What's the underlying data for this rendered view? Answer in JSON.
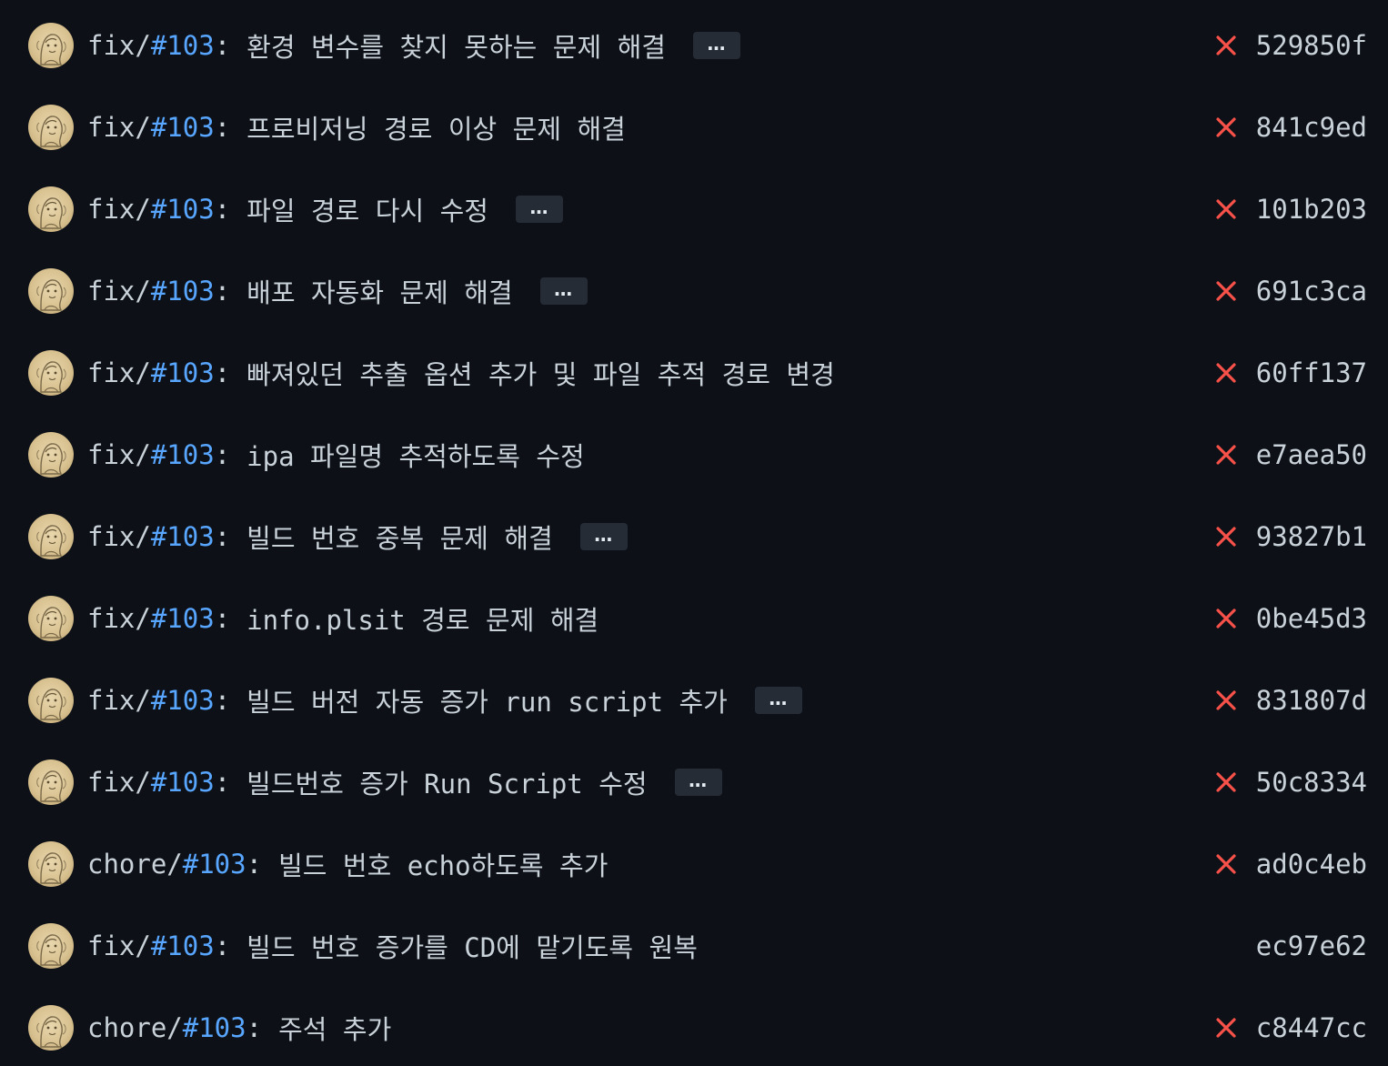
{
  "colors": {
    "background": "#0d1117",
    "text": "#c9d1d9",
    "issue_link": "#58a6ff",
    "status_failure": "#f85149",
    "ellipsis_button": "#262c36"
  },
  "commits": [
    {
      "prefix": "fix/",
      "issue": "#103",
      "colon": ":",
      "subject": "환경 변수를 찾지 못하는 문제 해결",
      "has_more": true,
      "more_label": "…",
      "status": "failure",
      "status_icon": "x-icon",
      "sha": "529850f"
    },
    {
      "prefix": "fix/",
      "issue": "#103",
      "colon": ":",
      "subject": "프로비저닝 경로 이상 문제 해결",
      "has_more": false,
      "more_label": "…",
      "status": "failure",
      "status_icon": "x-icon",
      "sha": "841c9ed"
    },
    {
      "prefix": "fix/",
      "issue": "#103",
      "colon": ":",
      "subject": "파일 경로 다시 수정",
      "has_more": true,
      "more_label": "…",
      "status": "failure",
      "status_icon": "x-icon",
      "sha": "101b203"
    },
    {
      "prefix": "fix/",
      "issue": "#103",
      "colon": ":",
      "subject": "배포 자동화 문제 해결",
      "has_more": true,
      "more_label": "…",
      "status": "failure",
      "status_icon": "x-icon",
      "sha": "691c3ca"
    },
    {
      "prefix": "fix/",
      "issue": "#103",
      "colon": ":",
      "subject": "빠져있던 추출 옵션 추가 및 파일 추적 경로 변경",
      "has_more": false,
      "more_label": "…",
      "status": "failure",
      "status_icon": "x-icon",
      "sha": "60ff137"
    },
    {
      "prefix": "fix/",
      "issue": "#103",
      "colon": ":",
      "subject": "ipa 파일명 추적하도록 수정",
      "has_more": false,
      "more_label": "…",
      "status": "failure",
      "status_icon": "x-icon",
      "sha": "e7aea50"
    },
    {
      "prefix": "fix/",
      "issue": "#103",
      "colon": ":",
      "subject": "빌드 번호 중복 문제 해결",
      "has_more": true,
      "more_label": "…",
      "status": "failure",
      "status_icon": "x-icon",
      "sha": "93827b1"
    },
    {
      "prefix": "fix/",
      "issue": "#103",
      "colon": ":",
      "subject": "info.plsit 경로 문제 해결",
      "has_more": false,
      "more_label": "…",
      "status": "failure",
      "status_icon": "x-icon",
      "sha": "0be45d3"
    },
    {
      "prefix": "fix/",
      "issue": "#103",
      "colon": ":",
      "subject": "빌드 버전 자동 증가 run script 추가",
      "has_more": true,
      "more_label": "…",
      "status": "failure",
      "status_icon": "x-icon",
      "sha": "831807d"
    },
    {
      "prefix": "fix/",
      "issue": "#103",
      "colon": ":",
      "subject": "빌드번호 증가 Run Script 수정",
      "has_more": true,
      "more_label": "…",
      "status": "failure",
      "status_icon": "x-icon",
      "sha": "50c8334"
    },
    {
      "prefix": "chore/",
      "issue": "#103",
      "colon": ":",
      "subject": "빌드 번호 echo하도록 추가",
      "has_more": false,
      "more_label": "…",
      "status": "failure",
      "status_icon": "x-icon",
      "sha": "ad0c4eb"
    },
    {
      "prefix": "fix/",
      "issue": "#103",
      "colon": ":",
      "subject": "빌드 번호 증가를 CD에 맡기도록 원복",
      "has_more": false,
      "more_label": "…",
      "status": "none",
      "status_icon": "",
      "sha": "ec97e62"
    },
    {
      "prefix": "chore/",
      "issue": "#103",
      "colon": ":",
      "subject": "주석 추가",
      "has_more": false,
      "more_label": "…",
      "status": "failure",
      "status_icon": "x-icon",
      "sha": "c8447cc"
    }
  ]
}
